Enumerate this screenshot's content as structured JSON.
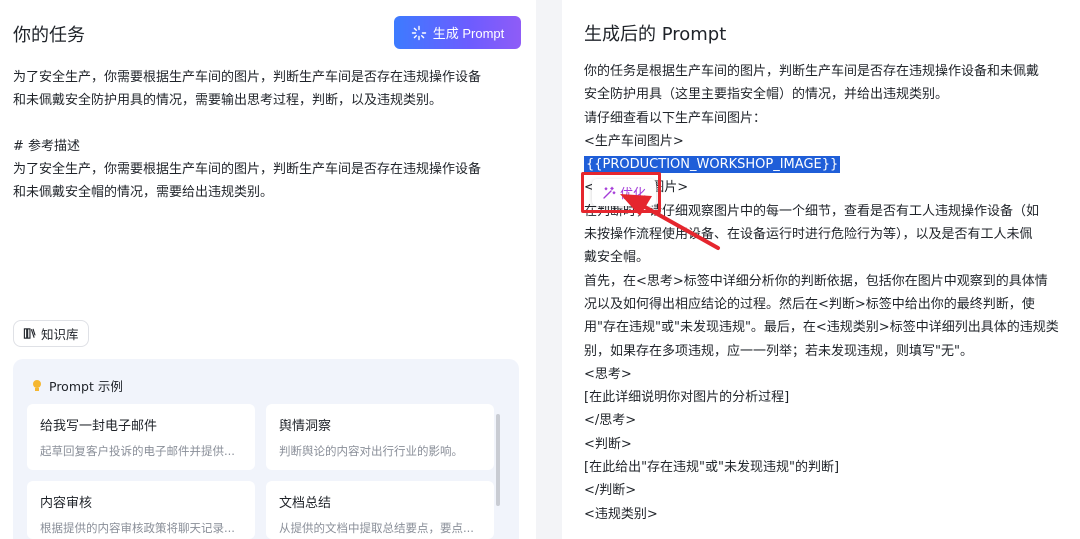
{
  "left": {
    "title": "你的任务",
    "generate_button": "生成 Prompt",
    "task_text": "为了安全生产，你需要根据生产车间的图片，判断生产车间是否存在违规操作设备\n和未佩戴安全防护用具的情况，需要输出思考过程，判断，以及违规类别。\n\n# 参考描述\n为了安全生产，你需要根据生产车间的图片，判断生产车间是否存在违规操作设备\n和未佩戴安全帽的情况，需要给出违规类别。",
    "knowledge_chip": "知识库",
    "examples": {
      "header": "Prompt 示例",
      "cards": [
        {
          "title": "给我写一封电子邮件",
          "desc": "起草回复客户投诉的电子邮件并提供..."
        },
        {
          "title": "舆情洞察",
          "desc": "判断舆论的内容对出行行业的影响。"
        },
        {
          "title": "内容审核",
          "desc": "根据提供的内容审核政策将聊天记录..."
        },
        {
          "title": "文档总结",
          "desc": "从提供的文档中提取总结要点，要点..."
        }
      ]
    }
  },
  "right": {
    "title": "生成后的 Prompt",
    "lines": [
      "你的任务是根据生产车间的图片，判断生产车间是否存在违规操作设备和未佩戴",
      "安全防护用具（这里主要指安全帽）的情况，并给出违规类别。",
      "请仔细查看以下生产车间图片：",
      "<生产车间图片>",
      "{{PRODUCTION_WORKSHOP_IMAGE}}",
      "</生产车间图片>",
      "在判断时，请仔细观察图片中的每一个细节，查看是否有工人违规操作设备（如",
      "未按操作流程使用设备、在设备运行时进行危险行为等），以及是否有工人未佩",
      "戴安全帽。",
      "首先，在<思考>标签中详细分析你的判断依据，包括你在图片中观察到的具体情",
      "况以及如何得出相应结论的过程。然后在<判断>标签中给出你的最终判断，使",
      "用\"存在违规\"或\"未发现违规\"。最后，在<违规类别>标签中详细列出具体的违规类",
      "别，如果存在多项违规，应一一列举；若未发现违规，则填写\"无\"。",
      "<思考>",
      "[在此详细说明你对图片的分析过程]",
      "</思考>",
      "<判断>",
      "[在此给出\"存在违规\"或\"未发现违规\"的判断]",
      "</判断>",
      "<违规类别>"
    ],
    "optimize_label": "优化"
  },
  "colors": {
    "accent_gradient_start": "#3d7bff",
    "accent_gradient_end": "#8f5cf7",
    "highlight": "#1f5ed8",
    "optimize_purple": "#a43bd8",
    "annotation_red": "#e5262e"
  }
}
